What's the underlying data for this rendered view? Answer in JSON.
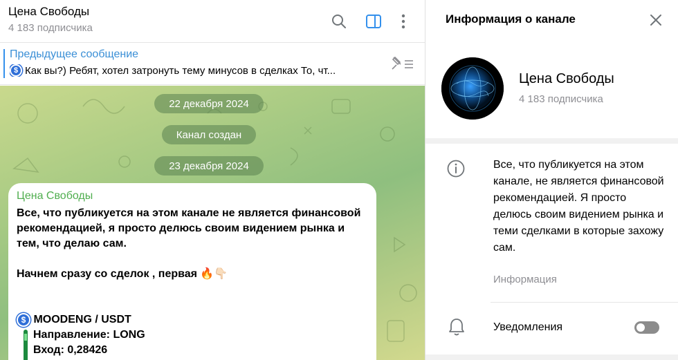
{
  "chat": {
    "title": "Цена Свободы",
    "subtitle": "4 183 подписчика",
    "header_icons": [
      "search-icon",
      "sidebar-toggle-icon",
      "more-vertical-icon"
    ],
    "pinned": {
      "title": "Предыдущее сообщение",
      "text": "Как вы?)  Ребят, хотел затронуть тему минусов в сделках  То, чт..."
    },
    "dates": [
      "22 декабря 2024",
      "Канал создан",
      "23 декабря 2024"
    ],
    "message": {
      "author": "Цена Свободы",
      "line1": "Все, что публикуется на этом канале не является финансовой",
      "line2": "рекомендацией, я просто делюсь своим видением рынка и",
      "line3": "тем, что делаю сам.",
      "line4": "Начнем сразу со сделок , первая 🔥👇🏻",
      "pair": "MOODENG / USDT",
      "direction": "Направление: LONG",
      "entry": "Вход: 0,28426"
    }
  },
  "info_panel": {
    "title": "Информация о канале",
    "channel_name": "Цена Свободы",
    "subscribers": "4 183 подписчика",
    "description": "Все, что публикуется на этом канале, не является финансовой рекомендацией. Я просто делюсь своим видением рынка и теми сделками в которые захожу сам.",
    "description_label": "Информация",
    "notifications_label": "Уведомления",
    "notifications_enabled": false
  },
  "colors": {
    "accent": "#3390ec",
    "author_green": "#4fae4e",
    "muted": "#8e8e93"
  }
}
